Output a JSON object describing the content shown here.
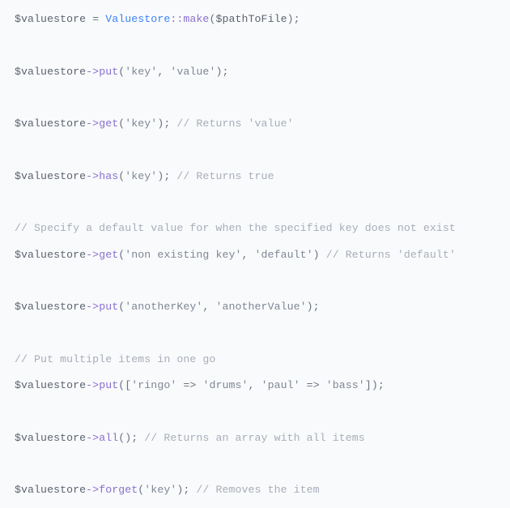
{
  "code": {
    "lines": [
      {
        "kind": "stmt",
        "tokens": [
          {
            "c": "var",
            "t": "$valuestore"
          },
          {
            "c": "default",
            "t": " = "
          },
          {
            "c": "class",
            "t": "Valuestore"
          },
          {
            "c": "op",
            "t": "::"
          },
          {
            "c": "method",
            "t": "make"
          },
          {
            "c": "default",
            "t": "("
          },
          {
            "c": "var",
            "t": "$pathToFile"
          },
          {
            "c": "default",
            "t": ");"
          }
        ]
      },
      {
        "kind": "blank"
      },
      {
        "kind": "stmt",
        "tokens": [
          {
            "c": "var",
            "t": "$valuestore"
          },
          {
            "c": "op",
            "t": "->"
          },
          {
            "c": "method",
            "t": "put"
          },
          {
            "c": "default",
            "t": "("
          },
          {
            "c": "str",
            "t": "'key'"
          },
          {
            "c": "default",
            "t": ", "
          },
          {
            "c": "str",
            "t": "'value'"
          },
          {
            "c": "default",
            "t": ");"
          }
        ]
      },
      {
        "kind": "blank"
      },
      {
        "kind": "stmt",
        "tokens": [
          {
            "c": "var",
            "t": "$valuestore"
          },
          {
            "c": "op",
            "t": "->"
          },
          {
            "c": "method",
            "t": "get"
          },
          {
            "c": "default",
            "t": "("
          },
          {
            "c": "str",
            "t": "'key'"
          },
          {
            "c": "default",
            "t": "); "
          },
          {
            "c": "comment",
            "t": "// Returns 'value'"
          }
        ]
      },
      {
        "kind": "blank"
      },
      {
        "kind": "stmt",
        "tokens": [
          {
            "c": "var",
            "t": "$valuestore"
          },
          {
            "c": "op",
            "t": "->"
          },
          {
            "c": "method",
            "t": "has"
          },
          {
            "c": "default",
            "t": "("
          },
          {
            "c": "str",
            "t": "'key'"
          },
          {
            "c": "default",
            "t": "); "
          },
          {
            "c": "comment",
            "t": "// Returns true"
          }
        ]
      },
      {
        "kind": "blank"
      },
      {
        "kind": "comment-line",
        "tokens": [
          {
            "c": "comment",
            "t": "// Specify a default value for when the specified key does not exist"
          }
        ]
      },
      {
        "kind": "stmt",
        "tokens": [
          {
            "c": "var",
            "t": "$valuestore"
          },
          {
            "c": "op",
            "t": "->"
          },
          {
            "c": "method",
            "t": "get"
          },
          {
            "c": "default",
            "t": "("
          },
          {
            "c": "str",
            "t": "'non existing key'"
          },
          {
            "c": "default",
            "t": ", "
          },
          {
            "c": "str",
            "t": "'default'"
          },
          {
            "c": "default",
            "t": ") "
          },
          {
            "c": "comment",
            "t": "// Returns 'default'"
          }
        ]
      },
      {
        "kind": "blank"
      },
      {
        "kind": "stmt",
        "tokens": [
          {
            "c": "var",
            "t": "$valuestore"
          },
          {
            "c": "op",
            "t": "->"
          },
          {
            "c": "method",
            "t": "put"
          },
          {
            "c": "default",
            "t": "("
          },
          {
            "c": "str",
            "t": "'anotherKey'"
          },
          {
            "c": "default",
            "t": ", "
          },
          {
            "c": "str",
            "t": "'anotherValue'"
          },
          {
            "c": "default",
            "t": ");"
          }
        ]
      },
      {
        "kind": "blank"
      },
      {
        "kind": "comment-line",
        "tokens": [
          {
            "c": "comment",
            "t": "// Put multiple items in one go"
          }
        ]
      },
      {
        "kind": "stmt",
        "tokens": [
          {
            "c": "var",
            "t": "$valuestore"
          },
          {
            "c": "op",
            "t": "->"
          },
          {
            "c": "method",
            "t": "put"
          },
          {
            "c": "default",
            "t": "(["
          },
          {
            "c": "str",
            "t": "'ringo'"
          },
          {
            "c": "default",
            "t": " => "
          },
          {
            "c": "str",
            "t": "'drums'"
          },
          {
            "c": "default",
            "t": ", "
          },
          {
            "c": "str",
            "t": "'paul'"
          },
          {
            "c": "default",
            "t": " => "
          },
          {
            "c": "str",
            "t": "'bass'"
          },
          {
            "c": "default",
            "t": "]);"
          }
        ]
      },
      {
        "kind": "blank"
      },
      {
        "kind": "stmt",
        "tokens": [
          {
            "c": "var",
            "t": "$valuestore"
          },
          {
            "c": "op",
            "t": "->"
          },
          {
            "c": "method",
            "t": "all"
          },
          {
            "c": "default",
            "t": "(); "
          },
          {
            "c": "comment",
            "t": "// Returns an array with all items"
          }
        ]
      },
      {
        "kind": "blank"
      },
      {
        "kind": "stmt",
        "tokens": [
          {
            "c": "var",
            "t": "$valuestore"
          },
          {
            "c": "op",
            "t": "->"
          },
          {
            "c": "method",
            "t": "forget"
          },
          {
            "c": "default",
            "t": "("
          },
          {
            "c": "str",
            "t": "'key'"
          },
          {
            "c": "default",
            "t": "); "
          },
          {
            "c": "comment",
            "t": "// Removes the item"
          }
        ]
      }
    ]
  }
}
